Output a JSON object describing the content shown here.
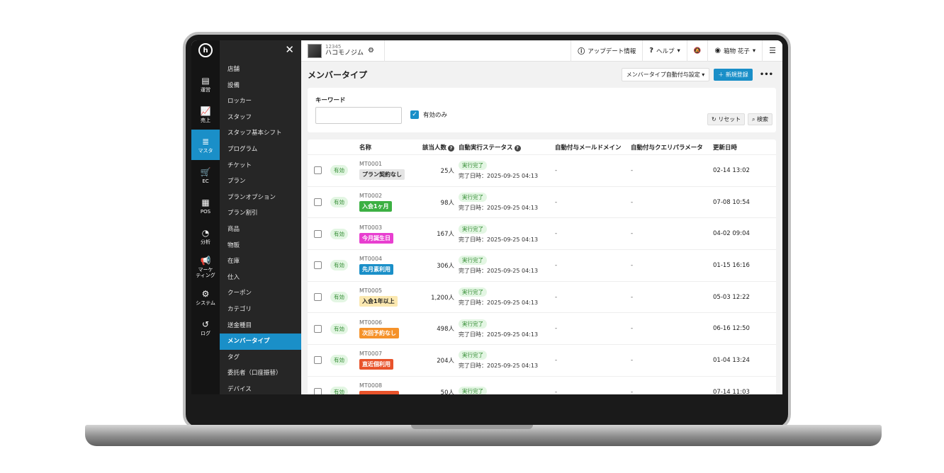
{
  "rail": {
    "items": [
      {
        "icon": "store-icon",
        "glyph": "▤",
        "label": "運営",
        "active": false
      },
      {
        "icon": "chart-icon",
        "glyph": "📈",
        "label": "売上",
        "active": false
      },
      {
        "icon": "database-icon",
        "glyph": "≣",
        "label": "マスタ",
        "active": true
      },
      {
        "icon": "cart-icon",
        "glyph": "🛒",
        "label": "EC",
        "active": false
      },
      {
        "icon": "register-icon",
        "glyph": "▦",
        "label": "POS",
        "active": false
      },
      {
        "icon": "pie-icon",
        "glyph": "◔",
        "label": "分析",
        "active": false
      },
      {
        "icon": "megaphone-icon",
        "glyph": "📢",
        "label": "マーケ\nティング",
        "active": false
      },
      {
        "icon": "gear-icon",
        "glyph": "⚙",
        "label": "システム",
        "active": false
      },
      {
        "icon": "history-icon",
        "glyph": "↺",
        "label": "ログ",
        "active": false
      }
    ]
  },
  "menu": {
    "close": "✕",
    "items": [
      "店舗",
      "設備",
      "ロッカー",
      "スタッフ",
      "スタッフ基本シフト",
      "プログラム",
      "チケット",
      "プラン",
      "プランオプション",
      "プラン割引",
      "商品",
      "物販",
      "在庫",
      "仕入",
      "クーポン",
      "カテゴリ",
      "送金種目",
      "メンバータイプ",
      "タグ",
      "委託者（口座振替）",
      "デバイス"
    ],
    "active_index": 17
  },
  "topbar": {
    "store_id": "12345",
    "store_name": "ハコモノジム",
    "update_info": "アップデート情報",
    "help": "ヘルプ",
    "user": "箱物 花子"
  },
  "page": {
    "title": "メンバータイプ",
    "auto_assign_btn": "メンバータイプ自動付与設定",
    "new_btn": "新規登録",
    "more": "•••"
  },
  "filter": {
    "keyword_label": "キーワード",
    "keyword_value": "",
    "active_only_label": "有効のみ",
    "active_only_checked": true,
    "reset_label": "リセット",
    "search_label": "検索"
  },
  "table": {
    "headers": {
      "name": "名称",
      "count": "該当人数",
      "status": "自動実行ステータス",
      "mail_domain": "自動付与メールドメイン",
      "query_param": "自動付与クエリパラメータ",
      "updated": "更新日時"
    },
    "rows": [
      {
        "valid": "有効",
        "code": "MT0001",
        "tag": "プラン契約なし",
        "tag_bg": "#e4e4e4",
        "tag_fg": "#222222",
        "count": "25人",
        "status": "実行完了",
        "completed": "完了日時：2025-09-25 04:13",
        "mail": "-",
        "param": "-",
        "updated": "02-14 13:02"
      },
      {
        "valid": "有効",
        "code": "MT0002",
        "tag": "入会1ヶ月",
        "tag_bg": "#3cb043",
        "tag_fg": "#ffffff",
        "count": "98人",
        "status": "実行完了",
        "completed": "完了日時：2025-09-25 04:13",
        "mail": "-",
        "param": "-",
        "updated": "07-08 10:54"
      },
      {
        "valid": "有効",
        "code": "MT0003",
        "tag": "今月誕生日",
        "tag_bg": "#e83fd0",
        "tag_fg": "#ffffff",
        "count": "167人",
        "status": "実行完了",
        "completed": "完了日時：2025-09-25 04:13",
        "mail": "-",
        "param": "-",
        "updated": "04-02 09:04"
      },
      {
        "valid": "有効",
        "code": "MT0004",
        "tag": "先月素利用",
        "tag_bg": "#1a8fc8",
        "tag_fg": "#ffffff",
        "count": "306人",
        "status": "実行完了",
        "completed": "完了日時：2025-09-25 04:13",
        "mail": "-",
        "param": "-",
        "updated": "01-15 16:16"
      },
      {
        "valid": "有効",
        "code": "MT0005",
        "tag": "入会1年以上",
        "tag_bg": "#fbe8b0",
        "tag_fg": "#222222",
        "count": "1,200人",
        "status": "実行完了",
        "completed": "完了日時：2025-09-25 04:13",
        "mail": "-",
        "param": "-",
        "updated": "05-03 12:22"
      },
      {
        "valid": "有効",
        "code": "MT0006",
        "tag": "次回予約なし",
        "tag_bg": "#f5922a",
        "tag_fg": "#ffffff",
        "count": "498人",
        "status": "実行完了",
        "completed": "完了日時：2025-09-25 04:13",
        "mail": "-",
        "param": "-",
        "updated": "06-16 12:50"
      },
      {
        "valid": "有効",
        "code": "MT0007",
        "tag": "直近個利用",
        "tag_bg": "#e8532b",
        "tag_fg": "#ffffff",
        "count": "204人",
        "status": "実行完了",
        "completed": "完了日時：2025-09-25 04:13",
        "mail": "-",
        "param": "-",
        "updated": "01-04 13:24"
      },
      {
        "valid": "有効",
        "code": "MT0008",
        "tag": "",
        "tag_bg": "#e8532b",
        "tag_fg": "#ffffff",
        "count": "50人",
        "status": "実行完了",
        "completed": "",
        "mail": "-",
        "param": "-",
        "updated": "07-14 11:03"
      }
    ]
  }
}
